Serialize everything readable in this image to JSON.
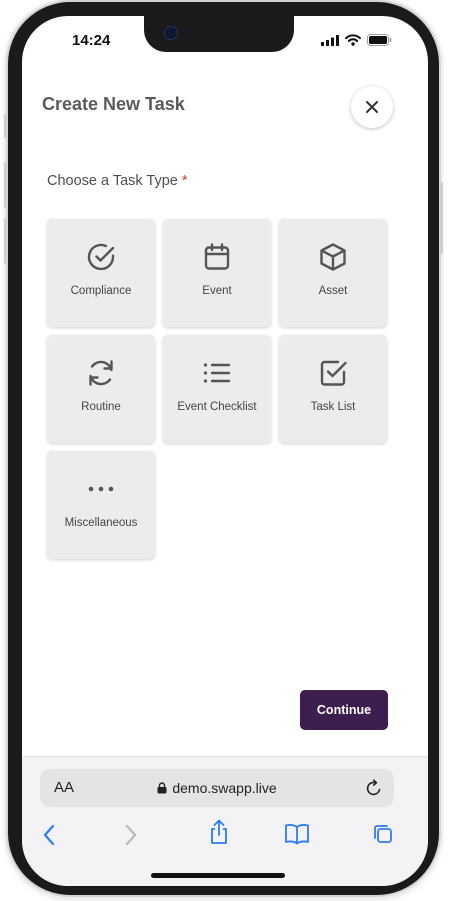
{
  "status_bar": {
    "time": "14:24"
  },
  "header": {
    "title": "Create New Task"
  },
  "task_type": {
    "label": "Choose a Task Type",
    "required_mark": "*",
    "options": [
      {
        "label": "Compliance",
        "icon": "check-circle-icon"
      },
      {
        "label": "Event",
        "icon": "calendar-icon"
      },
      {
        "label": "Asset",
        "icon": "cube-icon"
      },
      {
        "label": "Routine",
        "icon": "refresh-icon"
      },
      {
        "label": "Event Checklist",
        "icon": "list-icon"
      },
      {
        "label": "Task List",
        "icon": "checkbox-icon"
      },
      {
        "label": "Miscellaneous",
        "icon": "more-horizontal-icon"
      }
    ]
  },
  "actions": {
    "continue_label": "Continue"
  },
  "browser": {
    "aa_label": "AA",
    "url": "demo.swapp.live"
  },
  "colors": {
    "primary_button": "#3c1e4f",
    "tile_bg": "#ececec",
    "required": "#d03a3a",
    "link_blue": "#2f7bf6"
  }
}
